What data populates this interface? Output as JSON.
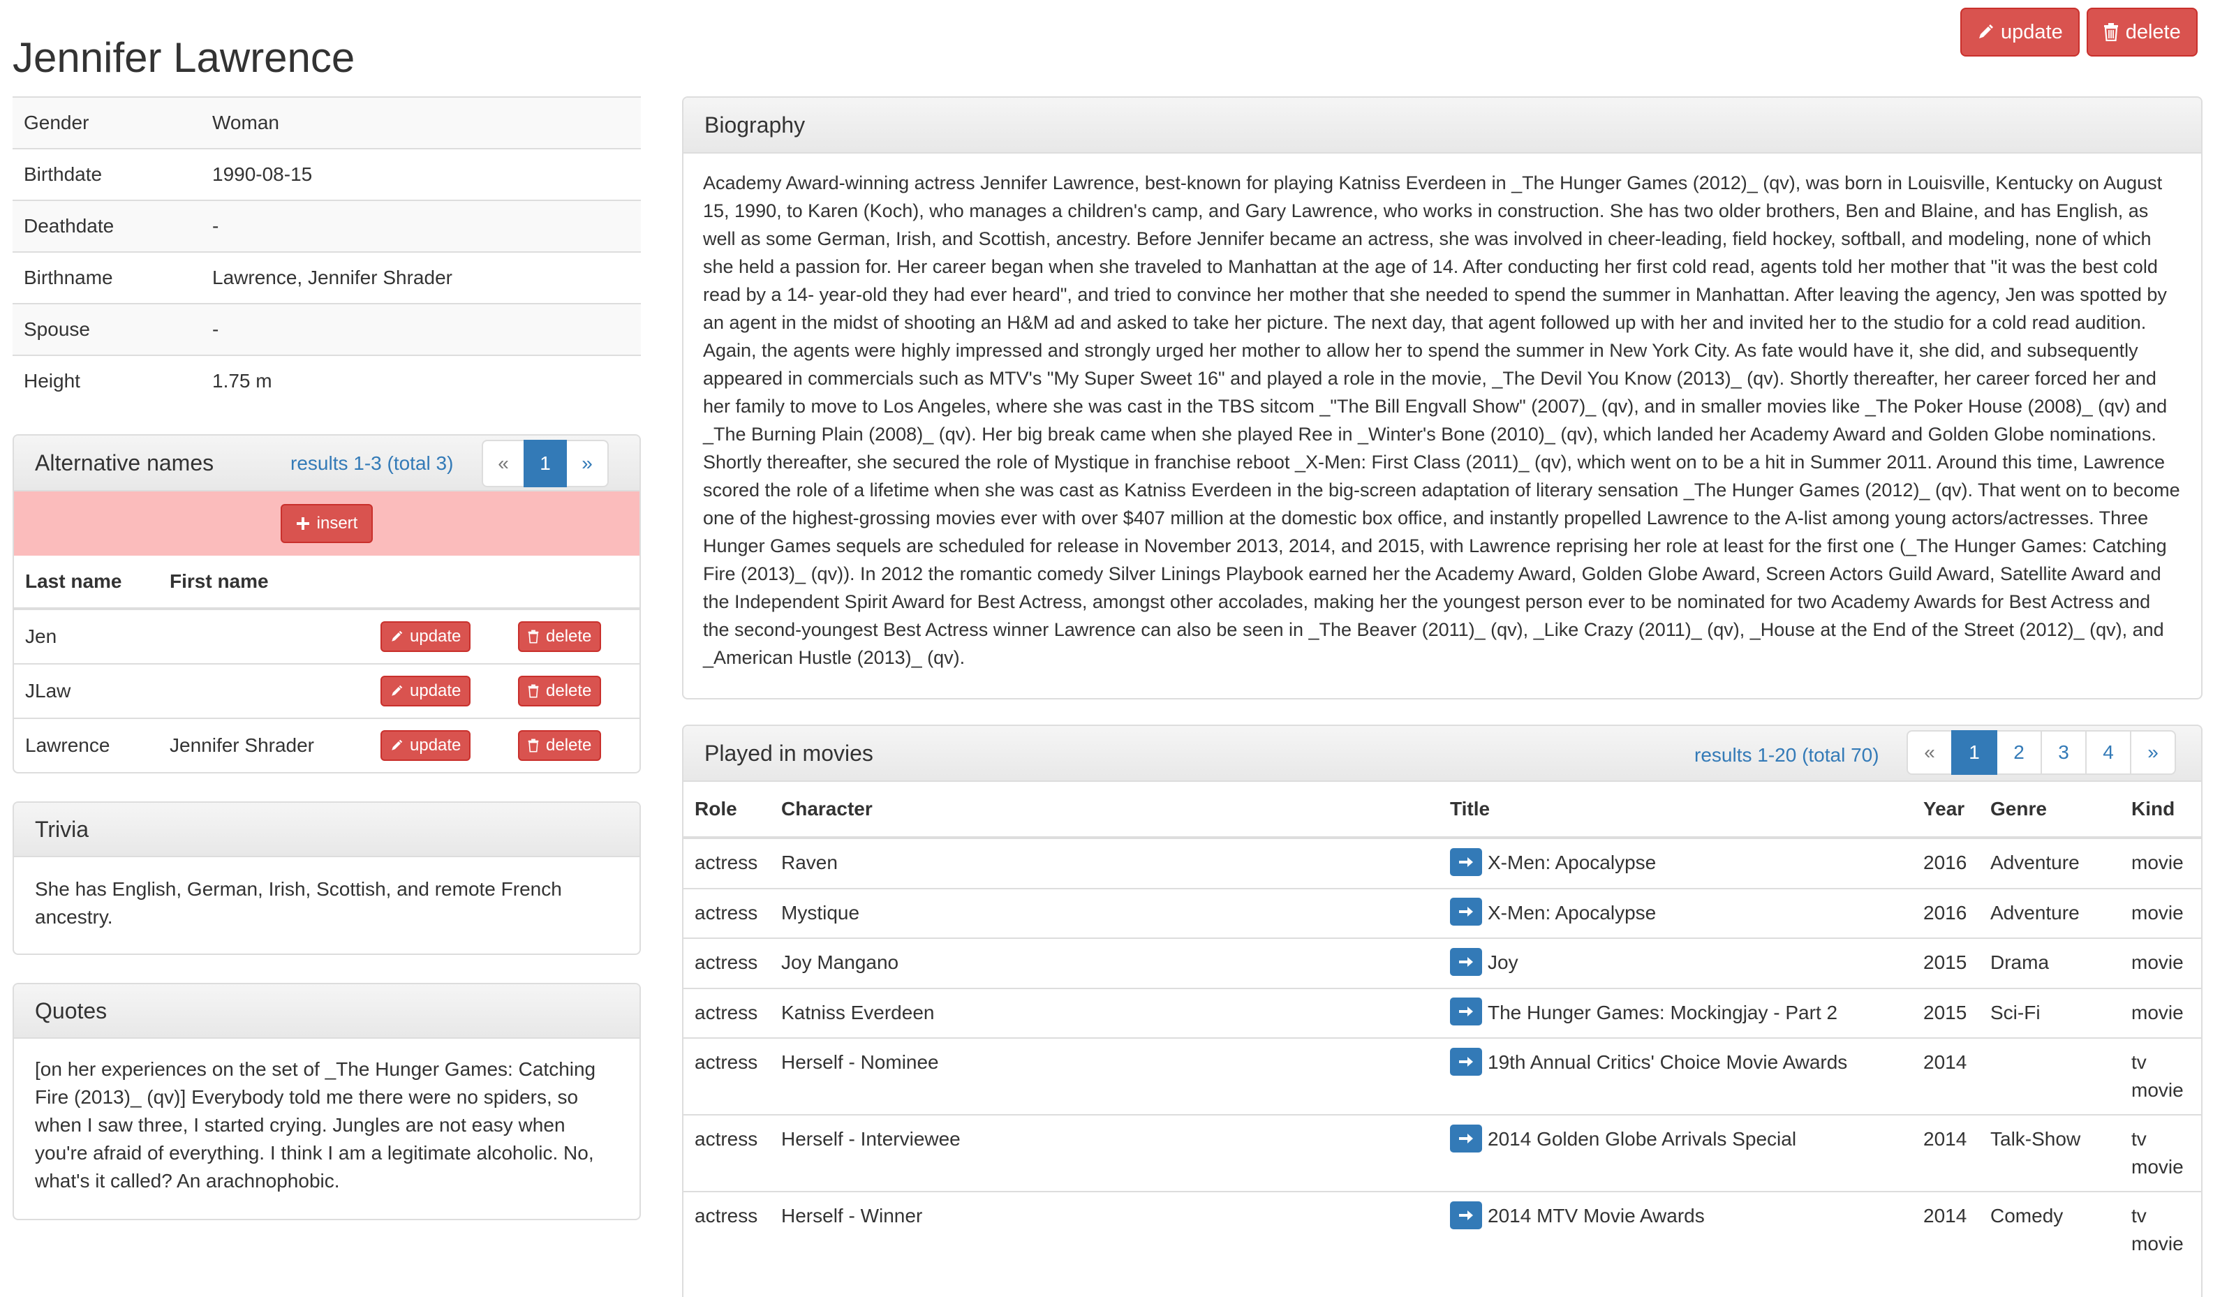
{
  "header": {
    "title": "Jennifer Lawrence",
    "update_label": "update",
    "delete_label": "delete"
  },
  "info": [
    {
      "label": "Gender",
      "value": "Woman"
    },
    {
      "label": "Birthdate",
      "value": "1990-08-15"
    },
    {
      "label": "Deathdate",
      "value": "-"
    },
    {
      "label": "Birthname",
      "value": "Lawrence, Jennifer Shrader"
    },
    {
      "label": "Spouse",
      "value": "-"
    },
    {
      "label": "Height",
      "value": "1.75 m"
    }
  ],
  "alt_names": {
    "title": "Alternative names",
    "results": "results 1-3 (total 3)",
    "pager": [
      "«",
      "1",
      "»"
    ],
    "insert_label": "insert",
    "columns": [
      "Last name",
      "First name"
    ],
    "rows": [
      {
        "last": "Jen",
        "first": ""
      },
      {
        "last": "JLaw",
        "first": ""
      },
      {
        "last": "Lawrence",
        "first": "Jennifer Shrader"
      }
    ],
    "update_label": "update",
    "delete_label": "delete"
  },
  "trivia": {
    "title": "Trivia",
    "text": "She has English, German, Irish, Scottish, and remote French ancestry."
  },
  "quotes": {
    "title": "Quotes",
    "text": "[on her experiences on the set of _The Hunger Games: Catching Fire (2013)_ (qv)] Everybody told me there were no spiders, so when I saw three, I started crying. Jungles are not easy when you're afraid of everything. I think I am a legitimate alcoholic. No, what's it called? An arachnophobic."
  },
  "biography": {
    "title": "Biography",
    "text": "Academy Award-winning actress Jennifer Lawrence, best-known for playing Katniss Everdeen in _The Hunger Games (2012)_ (qv), was born in Louisville, Kentucky on August 15, 1990, to Karen (Koch), who manages a children's camp, and Gary Lawrence, who works in construction. She has two older brothers, Ben and Blaine, and has English, as well as some German, Irish, and Scottish, ancestry. Before Jennifer became an actress, she was involved in cheer-leading, field hockey, softball, and modeling, none of which she held a passion for. Her career began when she traveled to Manhattan at the age of 14. After conducting her first cold read, agents told her mother that \"it was the best cold read by a 14- year-old they had ever heard\", and tried to convince her mother that she needed to spend the summer in Manhattan. After leaving the agency, Jen was spotted by an agent in the midst of shooting an H&M ad and asked to take her picture. The next day, that agent followed up with her and invited her to the studio for a cold read audition. Again, the agents were highly impressed and strongly urged her mother to allow her to spend the summer in New York City. As fate would have it, she did, and subsequently appeared in commercials such as MTV's \"My Super Sweet 16\" and played a role in the movie, _The Devil You Know (2013)_ (qv). Shortly thereafter, her career forced her and her family to move to Los Angeles, where she was cast in the TBS sitcom _\"The Bill Engvall Show\" (2007)_ (qv), and in smaller movies like _The Poker House (2008)_ (qv) and _The Burning Plain (2008)_ (qv). Her big break came when she played Ree in _Winter's Bone (2010)_ (qv), which landed her Academy Award and Golden Globe nominations. Shortly thereafter, she secured the role of Mystique in franchise reboot _X-Men: First Class (2011)_ (qv), which went on to be a hit in Summer 2011. Around this time, Lawrence scored the role of a lifetime when she was cast as Katniss Everdeen in the big-screen adaptation of literary sensation _The Hunger Games (2012)_ (qv). That went on to become one of the highest-grossing movies ever with over $407 million at the domestic box office, and instantly propelled Lawrence to the A-list among young actors/actresses. Three Hunger Games sequels are scheduled for release in November 2013, 2014, and 2015, with Lawrence reprising her role at least for the first one (_The Hunger Games: Catching Fire (2013)_ (qv)). In 2012 the romantic comedy Silver Linings Playbook earned her the Academy Award, Golden Globe Award, Screen Actors Guild Award, Satellite Award and the Independent Spirit Award for Best Actress, amongst other accolades, making her the youngest person ever to be nominated for two Academy Awards for Best Actress and the second-youngest Best Actress winner Lawrence can also be seen in _The Beaver (2011)_ (qv), _Like Crazy (2011)_ (qv), _House at the End of the Street (2012)_ (qv), and _American Hustle (2013)_ (qv)."
  },
  "movies": {
    "title": "Played in movies",
    "results": "results 1-20 (total 70)",
    "pager": [
      "«",
      "1",
      "2",
      "3",
      "4",
      "»"
    ],
    "columns": [
      "Role",
      "Character",
      "Title",
      "Year",
      "Genre",
      "Kind"
    ],
    "rows": [
      {
        "role": "actress",
        "character": "Raven",
        "title": "X-Men: Apocalypse",
        "year": "2016",
        "genre": "Adventure",
        "kind": "movie"
      },
      {
        "role": "actress",
        "character": "Mystique",
        "title": "X-Men: Apocalypse",
        "year": "2016",
        "genre": "Adventure",
        "kind": "movie"
      },
      {
        "role": "actress",
        "character": "Joy Mangano",
        "title": "Joy",
        "year": "2015",
        "genre": "Drama",
        "kind": "movie"
      },
      {
        "role": "actress",
        "character": "Katniss Everdeen",
        "title": "The Hunger Games: Mockingjay - Part 2",
        "year": "2015",
        "genre": "Sci-Fi",
        "kind": "movie"
      },
      {
        "role": "actress",
        "character": "Herself - Nominee",
        "title": "19th Annual Critics' Choice Movie Awards",
        "year": "2014",
        "genre": "",
        "kind": "tv movie"
      },
      {
        "role": "actress",
        "character": "Herself - Interviewee",
        "title": "2014 Golden Globe Arrivals Special",
        "year": "2014",
        "genre": "Talk-Show",
        "kind": "tv movie"
      },
      {
        "role": "actress",
        "character": "Herself - Winner",
        "title": "2014 MTV Movie Awards",
        "year": "2014",
        "genre": "Comedy",
        "kind": "tv movie"
      }
    ]
  },
  "colors": {
    "danger": "#d9534f",
    "primary": "#337ab7"
  },
  "icons": {
    "update": "pencil-icon",
    "delete": "trash-icon",
    "insert": "plus-icon",
    "go": "arrow-right-icon"
  }
}
